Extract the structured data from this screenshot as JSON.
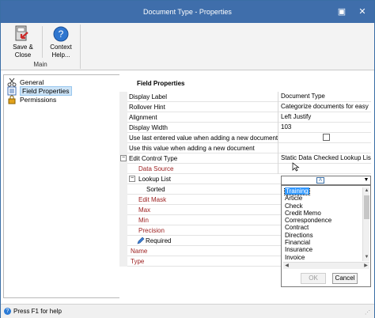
{
  "window": {
    "title": "Document Type - Properties",
    "restore_symbol": "▣",
    "close_symbol": "✕"
  },
  "ribbon": {
    "save_close_label": "Save &\nClose",
    "context_help_label": "Context\nHelp...",
    "group_label": "Main"
  },
  "nav": {
    "items": [
      {
        "label": "General",
        "icon": "scissors-icon"
      },
      {
        "label": "Field Properties",
        "icon": "field-list-icon"
      },
      {
        "label": "Permissions",
        "icon": "lock-icon"
      }
    ]
  },
  "main": {
    "title": "Field Properties",
    "rows": [
      {
        "label": "Display Label",
        "value": "Document Type"
      },
      {
        "label": "Rollover Hint",
        "value": "Categorize documents for easy"
      },
      {
        "label": "Alignment",
        "value": "Left Justify"
      },
      {
        "label": "Display Width",
        "value": "103"
      },
      {
        "label": "Use last entered value when adding a new document",
        "value": ""
      },
      {
        "label": "Use this value when adding a new document",
        "value": ""
      },
      {
        "label": "Edit Control Type",
        "value": "Static Data Checked Lookup List"
      },
      {
        "label": "Data Source",
        "value": ""
      },
      {
        "label": "Lookup List",
        "value": ""
      },
      {
        "label": "Sorted",
        "value": ""
      },
      {
        "label": "Edit Mask",
        "value": ""
      },
      {
        "label": "Max",
        "value": ""
      },
      {
        "label": "Min",
        "value": ""
      },
      {
        "label": "Precision",
        "value": ""
      },
      {
        "label": "Required",
        "value": ""
      },
      {
        "label": "Name",
        "value": ""
      },
      {
        "label": "Type",
        "value": ""
      }
    ]
  },
  "lookup_dropdown": {
    "items": [
      "Training",
      "Article",
      "Check",
      "Credit Memo",
      "Correspondence",
      "Contract",
      "Directions",
      "Financial",
      "Insurance",
      "Invoice"
    ],
    "selected": "Training",
    "ok_label": "OK",
    "cancel_label": "Cancel"
  },
  "status": {
    "text": "Press F1 for help"
  }
}
